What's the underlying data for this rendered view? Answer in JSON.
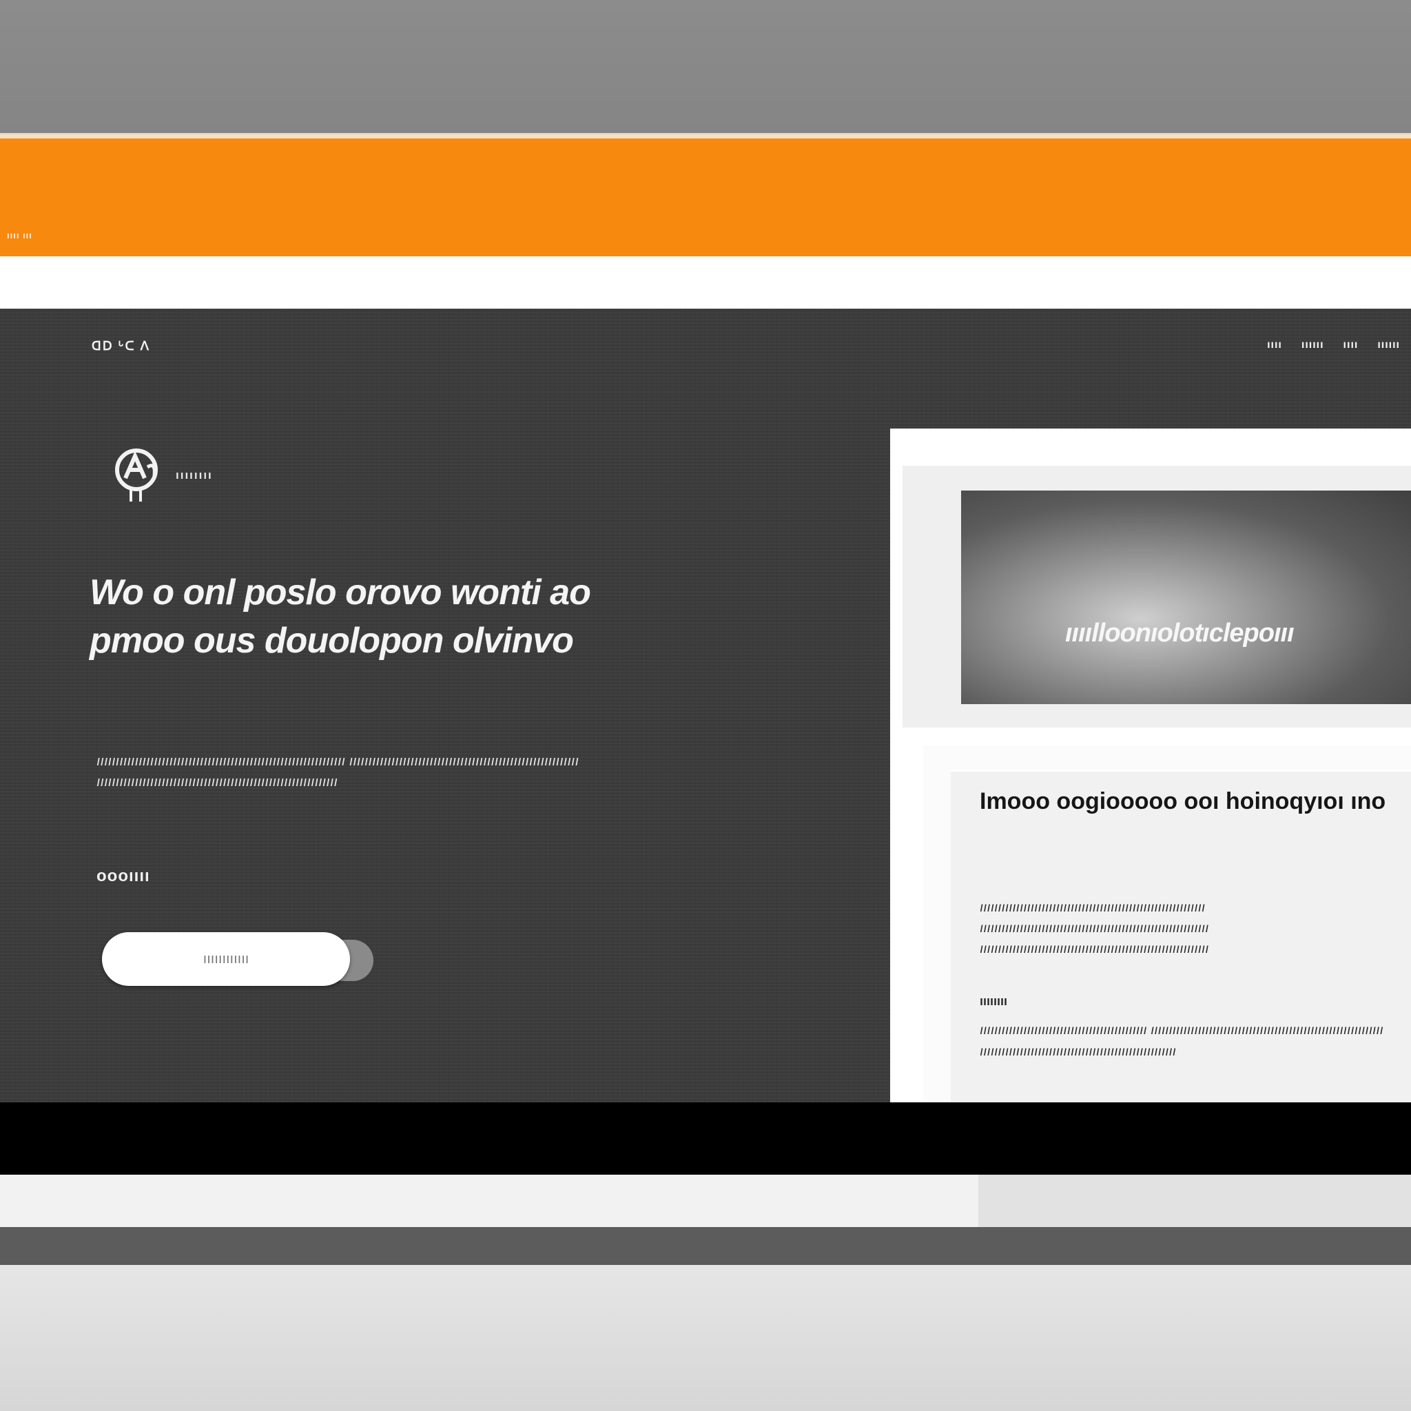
{
  "colors": {
    "accent_orange": "#f7890e",
    "hero_background": "#3b3b3c",
    "panel_background": "#ffffff",
    "text_light": "#f4f4f4",
    "text_dark": "#161616",
    "bar_black": "#000000"
  },
  "banner": {
    "caption": "ıııı ııı"
  },
  "header": {
    "brand": "ᗡᗞ ᒡᑕ ᐱ",
    "nav": [
      "ıııı",
      "ıııııı",
      "ıııı",
      "ıııııı"
    ]
  },
  "hero": {
    "logo_icon": "logo-emblem-icon",
    "logo_name": "ıııııııı",
    "headline": "Wo o onl poslo orovo wonti ao pmoo ous douolopon olvinvo",
    "intro": "ııııııııııııııııııııııııııııııııııııııııııııııııııııııııııııııııı ıııııııııııııııııııııııııııııııııııııııııııııııııııııııııııı ııııııııııııııııııııııııııııııııııııııııııııııııııııııııııııııı",
    "label": "oooıııı",
    "cta_label": "ıııııııııııı"
  },
  "panel": {
    "media_caption": "ıııılloonıolotıclepoııı",
    "card_title": "Imooo oogiooooo ooı hoinoqyıoı ıno",
    "card_body": "ıııııııııııııııııııııııııııııııııııııııııııııııııııııııııııııı ııııııııııııııııııııııııııııııııııııııııııııııııııııııııııııııı ııııııııııııııııııııııııııııııııııııııııııııııııııııııııııııııı",
    "card_subheading": "ıııııııı",
    "card_body2": "ıııııııııııııııııııııııııııııııııııııııııııııı ıııııııııııııııııııııııııııııııııııııııııııııııııııııııııııııııı ıııııııııııııııııııııııııııııııııııııııııııııııııııııı"
  }
}
